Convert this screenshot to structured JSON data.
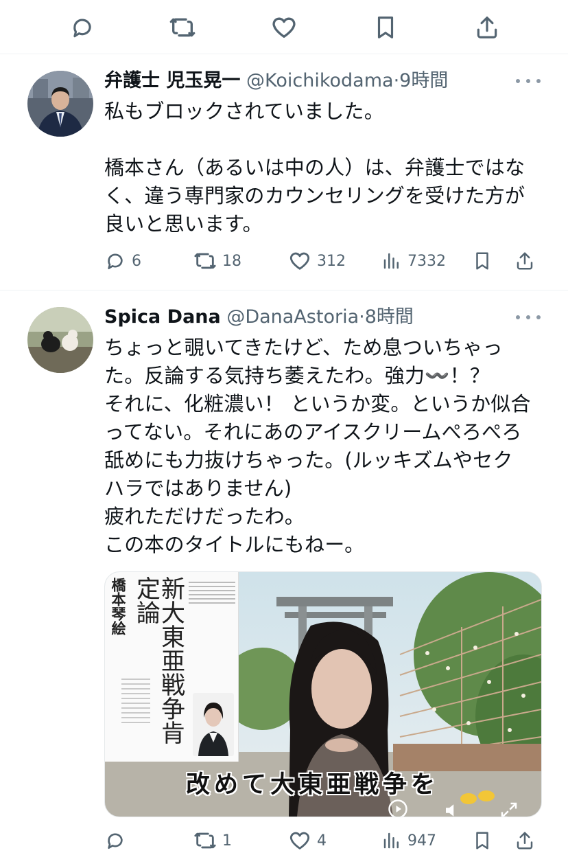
{
  "top_actions": [
    {
      "name": "reply-icon"
    },
    {
      "name": "retweet-icon"
    },
    {
      "name": "like-icon"
    },
    {
      "name": "bookmark-icon"
    },
    {
      "name": "share-icon"
    }
  ],
  "tweets": [
    {
      "display_name": "弁護士 児玉晃一",
      "handle": "@Koichikodama",
      "separator": "·",
      "time": "9時間",
      "lines_block1": [
        "私もブロックされていました。"
      ],
      "lines_block2": [
        "橋本さん（あるいは中の人）は、弁護士ではな",
        "く、違う専門家のカウンセリングを受けた方が",
        "良いと思います。"
      ],
      "replies": "6",
      "retweets": "18",
      "likes": "312",
      "views": "7332"
    },
    {
      "display_name": "Spica Dana",
      "handle": "@DanaAstoria",
      "separator": "·",
      "time": "8時間",
      "lines": [
        "ちょっと覗いてきたけど、ため息ついちゃっ",
        "た。反論する気持ち萎えたわ。強力〰️！？",
        "それに、化粧濃い！ というか変。というか似合",
        "ってない。それにあのアイスクリームぺろぺろ",
        "舐めにも力抜けちゃった。(ルッキズムやセク",
        "ハラではありません)",
        "疲れただけだったわ。",
        "この本のタイトルにもねー。"
      ],
      "media": {
        "book_author": "橋本琴絵",
        "book_title": "新大東亜戦争肯定論",
        "caption": "改めて大東亜戦争を"
      },
      "replies": "",
      "retweets": "1",
      "likes": "4",
      "views": "947"
    }
  ],
  "colors": {
    "text": "#0f1419",
    "muted": "#536471",
    "divider": "#eff3f4"
  }
}
